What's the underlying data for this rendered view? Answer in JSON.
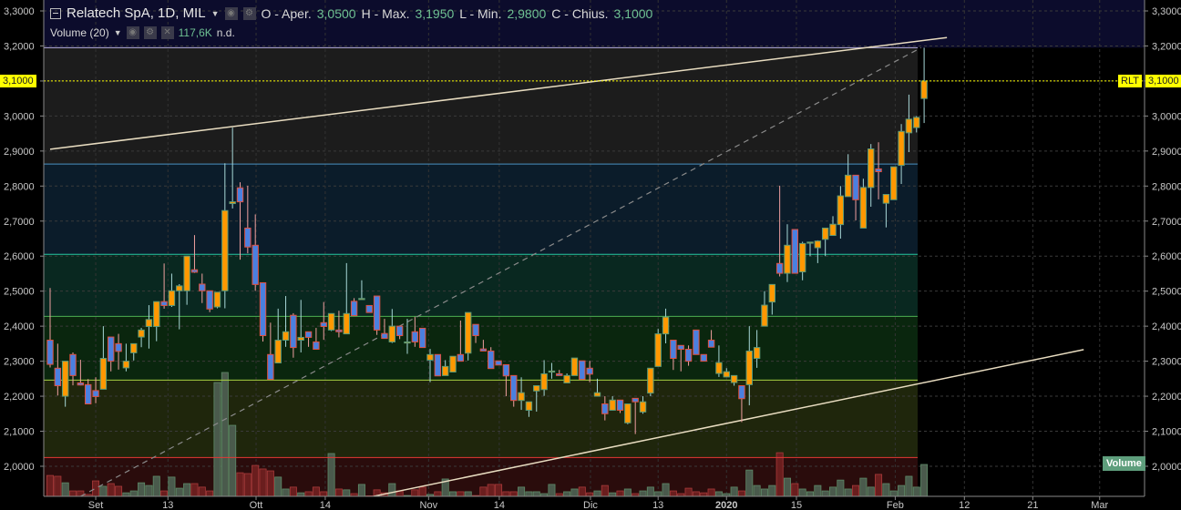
{
  "legend": {
    "symbol": "Relatech SpA, 1D, MIL",
    "open_label": "O - Aper.",
    "open": "3,0500",
    "high_label": "H - Max.",
    "high": "3,1950",
    "low_label": "L - Min.",
    "low": "2,9800",
    "close_label": "C - Chius.",
    "close": "3,1000",
    "volume_label": "Volume (20)",
    "volume_value": "117,6K",
    "volume_ma": "n.d."
  },
  "price_tag": {
    "ticker": "RLT",
    "price": "3,1000"
  },
  "volume_tag": "Volume",
  "colors": {
    "up": "#ff9800",
    "down": "#4a80e0",
    "last_price": "#ffff00"
  },
  "chart_data": {
    "type": "candlestick",
    "y_range": [
      2.0,
      3.3
    ],
    "y_ticks": [
      "3,3000",
      "3,2000",
      "3,1000",
      "3,0000",
      "2,9000",
      "2,8000",
      "2,7000",
      "2,6000",
      "2,5000",
      "2,4000",
      "2,3000",
      "2,2000",
      "2,1000",
      "2,0000"
    ],
    "x_labels": [
      {
        "label": "Set",
        "index": 6
      },
      {
        "label": "13",
        "index": 15.5
      },
      {
        "label": "Ott",
        "index": 27.1
      },
      {
        "label": "14",
        "index": 36.2
      },
      {
        "label": "Nov",
        "index": 49.8
      },
      {
        "label": "14",
        "index": 59.1
      },
      {
        "label": "Dic",
        "index": 71.1
      },
      {
        "label": "13",
        "index": 80
      },
      {
        "label": "2020",
        "index": 89
      },
      {
        "label": "15",
        "index": 98.2
      },
      {
        "label": "Feb",
        "index": 111.2
      },
      {
        "label": "12",
        "index": 120.3
      },
      {
        "label": "21",
        "index": 129.3
      },
      {
        "label": "Mar",
        "index": 138.1
      }
    ],
    "fib_levels": [
      {
        "price": 3.195,
        "color": "#b8b0e0"
      },
      {
        "price": 2.863,
        "color": "#4a90c0"
      },
      {
        "price": 2.605,
        "color": "#26c6a0"
      },
      {
        "price": 2.428,
        "color": "#4caf50"
      },
      {
        "price": 2.246,
        "color": "#a8d040"
      },
      {
        "price": 2.025,
        "color": "#e53935"
      }
    ],
    "trendlines": [
      {
        "from": [
          0,
          2.905
        ],
        "to": [
          118,
          3.224
        ],
        "style": "solid"
      },
      {
        "from": [
          42.5,
          1.914
        ],
        "to": [
          136,
          2.333
        ],
        "style": "solid"
      },
      {
        "from": [
          4,
          1.914
        ],
        "to": [
          114.6,
          3.195
        ],
        "style": "dashed"
      }
    ],
    "last_price": 3.1,
    "ohlc": [
      [
        2.36,
        2.509,
        2.282,
        2.291
      ],
      [
        2.28,
        2.35,
        2.202,
        2.23
      ],
      [
        2.2,
        2.3,
        2.17,
        2.3
      ],
      [
        2.319,
        2.325,
        2.231,
        2.259
      ],
      [
        2.238,
        2.304,
        2.231,
        2.232
      ],
      [
        2.233,
        2.249,
        2.178,
        2.178
      ],
      [
        2.216,
        2.254,
        2.18,
        2.199
      ],
      [
        2.22,
        2.4,
        2.22,
        2.308
      ],
      [
        2.369,
        2.369,
        2.271,
        2.3
      ],
      [
        2.35,
        2.378,
        2.276,
        2.328
      ],
      [
        2.281,
        2.35,
        2.271,
        2.3
      ],
      [
        2.324,
        2.35,
        2.302,
        2.35
      ],
      [
        2.369,
        2.395,
        2.34,
        2.389
      ],
      [
        2.399,
        2.46,
        2.336,
        2.419
      ],
      [
        2.399,
        2.47,
        2.357,
        2.47
      ],
      [
        2.47,
        2.579,
        2.45,
        2.459
      ],
      [
        2.459,
        2.55,
        2.455,
        2.501
      ],
      [
        2.501,
        2.52,
        2.391,
        2.515
      ],
      [
        2.501,
        2.6,
        2.461,
        2.6
      ],
      [
        2.561,
        2.66,
        2.552,
        2.554
      ],
      [
        2.52,
        2.55,
        2.466,
        2.501
      ],
      [
        2.501,
        2.501,
        2.44,
        2.449
      ],
      [
        2.455,
        2.497,
        2.451,
        2.497
      ],
      [
        2.501,
        2.865,
        2.451,
        2.73
      ],
      [
        2.75,
        2.967,
        2.736,
        2.755
      ],
      [
        2.795,
        2.811,
        2.59,
        2.755
      ],
      [
        2.68,
        2.801,
        2.608,
        2.626
      ],
      [
        2.631,
        2.719,
        2.501,
        2.519
      ],
      [
        2.524,
        2.524,
        2.356,
        2.373
      ],
      [
        2.319,
        2.41,
        2.248,
        2.248
      ],
      [
        2.295,
        2.45,
        2.295,
        2.36
      ],
      [
        2.36,
        2.486,
        2.341,
        2.384
      ],
      [
        2.431,
        2.437,
        2.31,
        2.339
      ],
      [
        2.36,
        2.475,
        2.325,
        2.368
      ],
      [
        2.384,
        2.384,
        2.341,
        2.368
      ],
      [
        2.355,
        2.395,
        2.334,
        2.334
      ],
      [
        2.41,
        2.469,
        2.361,
        2.399
      ],
      [
        2.389,
        2.436,
        2.386,
        2.436
      ],
      [
        2.389,
        2.444,
        2.368,
        2.384
      ],
      [
        2.378,
        2.58,
        2.378,
        2.436
      ],
      [
        2.471,
        2.48,
        2.43,
        2.43
      ],
      [
        2.479,
        2.531,
        2.476,
        2.479
      ],
      [
        2.459,
        2.459,
        2.439,
        2.439
      ],
      [
        2.486,
        2.486,
        2.375,
        2.389
      ],
      [
        2.379,
        2.421,
        2.365,
        2.365
      ],
      [
        2.355,
        2.449,
        2.352,
        2.4
      ],
      [
        2.4,
        2.4,
        2.363,
        2.373
      ],
      [
        2.355,
        2.421,
        2.321,
        2.355
      ],
      [
        2.384,
        2.427,
        2.341,
        2.355
      ],
      [
        2.394,
        2.394,
        2.339,
        2.339
      ],
      [
        2.303,
        2.335,
        2.24,
        2.319
      ],
      [
        2.319,
        2.319,
        2.258,
        2.258
      ],
      [
        2.259,
        2.303,
        2.259,
        2.285
      ],
      [
        2.269,
        2.314,
        2.269,
        2.314
      ],
      [
        2.319,
        2.416,
        2.3,
        2.3
      ],
      [
        2.323,
        2.439,
        2.302,
        2.439
      ],
      [
        2.405,
        2.405,
        2.352,
        2.373
      ],
      [
        2.335,
        2.361,
        2.329,
        2.329
      ],
      [
        2.329,
        2.34,
        2.279,
        2.279
      ],
      [
        2.301,
        2.301,
        2.289,
        2.289
      ],
      [
        2.29,
        2.29,
        2.2,
        2.258
      ],
      [
        2.259,
        2.259,
        2.17,
        2.188
      ],
      [
        2.188,
        2.254,
        2.161,
        2.21
      ],
      [
        2.16,
        2.184,
        2.141,
        2.184
      ],
      [
        2.215,
        2.23,
        2.156,
        2.23
      ],
      [
        2.219,
        2.303,
        2.201,
        2.264
      ],
      [
        2.272,
        2.295,
        2.25,
        2.272
      ],
      [
        2.264,
        2.275,
        2.259,
        2.259
      ],
      [
        2.238,
        2.265,
        2.238,
        2.259
      ],
      [
        2.259,
        2.309,
        2.259,
        2.309
      ],
      [
        2.301,
        2.301,
        2.248,
        2.248
      ],
      [
        2.28,
        2.301,
        2.24,
        2.263
      ],
      [
        2.2,
        2.25,
        2.2,
        2.21
      ],
      [
        2.178,
        2.2,
        2.131,
        2.15
      ],
      [
        2.16,
        2.2,
        2.16,
        2.189
      ],
      [
        2.189,
        2.189,
        2.152,
        2.16
      ],
      [
        2.124,
        2.178,
        2.12,
        2.178
      ],
      [
        2.194,
        2.194,
        2.092,
        2.184
      ],
      [
        2.155,
        2.2,
        2.15,
        2.184
      ],
      [
        2.209,
        2.28,
        2.2,
        2.28
      ],
      [
        2.285,
        2.392,
        2.285,
        2.378
      ],
      [
        2.378,
        2.45,
        2.351,
        2.426
      ],
      [
        2.36,
        2.36,
        2.275,
        2.308
      ],
      [
        2.345,
        2.345,
        2.271,
        2.334
      ],
      [
        2.334,
        2.345,
        2.287,
        2.3
      ],
      [
        2.389,
        2.389,
        2.319,
        2.319
      ],
      [
        2.319,
        2.319,
        2.3,
        2.3
      ],
      [
        2.36,
        2.389,
        2.34,
        2.34
      ],
      [
        2.265,
        2.345,
        2.255,
        2.296
      ],
      [
        2.255,
        2.28,
        2.255,
        2.27
      ],
      [
        2.239,
        2.259,
        2.23,
        2.259
      ],
      [
        2.23,
        2.23,
        2.126,
        2.193
      ],
      [
        2.233,
        2.4,
        2.174,
        2.329
      ],
      [
        2.308,
        2.389,
        2.281,
        2.339
      ],
      [
        2.4,
        2.5,
        2.433,
        2.46
      ],
      [
        2.469,
        2.519,
        2.433,
        2.519
      ],
      [
        2.579,
        2.801,
        2.542,
        2.551
      ],
      [
        2.551,
        2.691,
        2.526,
        2.631
      ],
      [
        2.676,
        2.676,
        2.551,
        2.551
      ],
      [
        2.555,
        2.641,
        2.531,
        2.636
      ],
      [
        2.64,
        2.64,
        2.6,
        2.64
      ],
      [
        2.624,
        2.645,
        2.58,
        2.643
      ],
      [
        2.648,
        2.68,
        2.6,
        2.68
      ],
      [
        2.659,
        2.714,
        2.659,
        2.691
      ],
      [
        2.69,
        2.8,
        2.65,
        2.772
      ],
      [
        2.77,
        2.891,
        2.77,
        2.831
      ],
      [
        2.831,
        2.831,
        2.702,
        2.761
      ],
      [
        2.68,
        2.821,
        2.68,
        2.796
      ],
      [
        2.796,
        2.92,
        2.741,
        2.906
      ],
      [
        2.849,
        2.925,
        2.762,
        2.841
      ],
      [
        2.751,
        2.776,
        2.682,
        2.776
      ],
      [
        2.761,
        2.855,
        2.806,
        2.855
      ],
      [
        2.859,
        2.977,
        2.806,
        2.956
      ],
      [
        2.952,
        3.061,
        2.897,
        2.991
      ],
      [
        2.967,
        3.0,
        2.953,
        2.996
      ],
      [
        3.05,
        3.195,
        2.98,
        3.1
      ]
    ],
    "volume_k": [
      77,
      74,
      50,
      20,
      20,
      7,
      57,
      37,
      47,
      37,
      13,
      20,
      50,
      40,
      74,
      20,
      71,
      30,
      47,
      47,
      34,
      20,
      420,
      457,
      262,
      87,
      84,
      114,
      101,
      94,
      71,
      27,
      34,
      13,
      17,
      34,
      17,
      158,
      27,
      24,
      10,
      44,
      2,
      24,
      13,
      47,
      20,
      3,
      24,
      34,
      7,
      17,
      64,
      17,
      17,
      17,
      3,
      34,
      44,
      44,
      17,
      17,
      34,
      17,
      17,
      10,
      44,
      10,
      17,
      27,
      34,
      13,
      20,
      40,
      13,
      20,
      27,
      10,
      20,
      34,
      17,
      47,
      20,
      10,
      30,
      17,
      13,
      27,
      17,
      10,
      34,
      20,
      97,
      40,
      27,
      40,
      161,
      67,
      47,
      27,
      17,
      40,
      20,
      34,
      60,
      27,
      40,
      67,
      34,
      81,
      47,
      20,
      40,
      74,
      34,
      117.6
    ]
  }
}
